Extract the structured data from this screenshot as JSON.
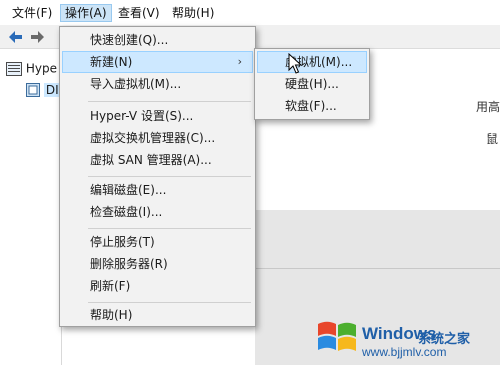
{
  "menubar": {
    "items": [
      {
        "label": "文件(F)"
      },
      {
        "label": "操作(A)"
      },
      {
        "label": "查看(V)"
      },
      {
        "label": "帮助(H)"
      }
    ]
  },
  "tree": {
    "items": [
      {
        "label": "Hype"
      },
      {
        "label": "DI"
      }
    ]
  },
  "background_text": {
    "right_1": "用高",
    "right_2": "鼠"
  },
  "action_menu": {
    "items": [
      {
        "label": "快速创建(Q)..."
      },
      {
        "label": "新建(N)"
      },
      {
        "label": "导入虚拟机(M)..."
      },
      {
        "label": "Hyper-V 设置(S)..."
      },
      {
        "label": "虚拟交换机管理器(C)..."
      },
      {
        "label": "虚拟 SAN 管理器(A)..."
      },
      {
        "label": "编辑磁盘(E)..."
      },
      {
        "label": "检查磁盘(I)..."
      },
      {
        "label": "停止服务(T)"
      },
      {
        "label": "删除服务器(R)"
      },
      {
        "label": "刷新(F)"
      },
      {
        "label": "帮助(H)"
      }
    ],
    "submenu_arrow": "›"
  },
  "new_submenu": {
    "items": [
      {
        "label": "虚拟机(M)..."
      },
      {
        "label": "硬盘(H)..."
      },
      {
        "label": "软盘(F)..."
      }
    ]
  },
  "watermark": {
    "brand": "Windows",
    "subtitle": "系统之家",
    "url": "www.bjjmlv.com"
  },
  "colors": {
    "menu_highlight": "#cde8ff",
    "menu_bg": "#f2f2f2",
    "watermark_blue": "#1f5fa8"
  }
}
